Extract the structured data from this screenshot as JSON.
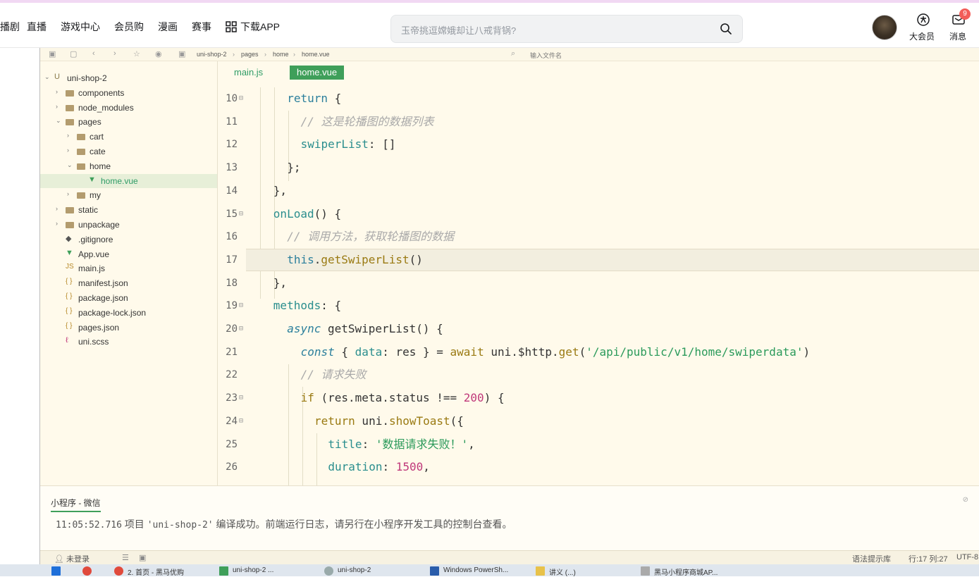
{
  "site_header": {
    "nav": [
      "播剧",
      "直播",
      "游戏中心",
      "会员购",
      "漫画",
      "赛事",
      "下载APP"
    ],
    "search_placeholder": "玉帝挑逗嫦娥却让八戒背锅?",
    "vip_label": "大会员",
    "messages_label": "消息",
    "message_badge": "9"
  },
  "ide": {
    "breadcrumb": [
      "uni-shop-2",
      "pages",
      "home",
      "home.vue"
    ],
    "file_search_placeholder": "输入文件名",
    "tree": [
      {
        "label": "uni-shop-2",
        "type": "project",
        "expanded": true
      },
      {
        "label": "components",
        "type": "folder"
      },
      {
        "label": "node_modules",
        "type": "folder"
      },
      {
        "label": "pages",
        "type": "folder",
        "expanded": true
      },
      {
        "label": "cart",
        "type": "folder"
      },
      {
        "label": "cate",
        "type": "folder"
      },
      {
        "label": "home",
        "type": "folder",
        "expanded": true
      },
      {
        "label": "home.vue",
        "type": "vue",
        "selected": true
      },
      {
        "label": "my",
        "type": "folder"
      },
      {
        "label": "static",
        "type": "folder"
      },
      {
        "label": "unpackage",
        "type": "folder"
      },
      {
        "label": ".gitignore",
        "type": "git"
      },
      {
        "label": "App.vue",
        "type": "vue"
      },
      {
        "label": "main.js",
        "type": "js"
      },
      {
        "label": "manifest.json",
        "type": "json"
      },
      {
        "label": "package.json",
        "type": "json"
      },
      {
        "label": "package-lock.json",
        "type": "json"
      },
      {
        "label": "pages.json",
        "type": "json"
      },
      {
        "label": "uni.scss",
        "type": "scss"
      }
    ],
    "tabs": [
      {
        "label": "main.js",
        "active": false
      },
      {
        "label": "home.vue",
        "active": true
      }
    ],
    "code_lines": [
      {
        "n": "10",
        "fold": true,
        "tokens": [
          [
            "kw",
            "return"
          ],
          [
            "p",
            " {"
          ]
        ]
      },
      {
        "n": "11",
        "fold": false,
        "tokens": [
          [
            "cm",
            "// 这是轮播图的数据列表"
          ]
        ]
      },
      {
        "n": "12",
        "fold": false,
        "tokens": [
          [
            "prop",
            "swiperList"
          ],
          [
            "p",
            ": []"
          ]
        ]
      },
      {
        "n": "13",
        "fold": false,
        "tokens": [
          [
            "p",
            "};"
          ]
        ]
      },
      {
        "n": "14",
        "fold": false,
        "tokens": [
          [
            "p",
            "},"
          ]
        ]
      },
      {
        "n": "15",
        "fold": true,
        "tokens": [
          [
            "prop",
            "onLoad"
          ],
          [
            "p",
            "() {"
          ]
        ]
      },
      {
        "n": "16",
        "fold": false,
        "tokens": [
          [
            "cm",
            "// 调用方法，获取轮播图的数据"
          ]
        ]
      },
      {
        "n": "17",
        "fold": false,
        "tokens": [
          [
            "kw",
            "this"
          ],
          [
            "p",
            "."
          ],
          [
            "fn",
            "getSwiperList"
          ],
          [
            "p",
            "()"
          ]
        ],
        "highlight": true
      },
      {
        "n": "18",
        "fold": false,
        "tokens": [
          [
            "p",
            "},"
          ]
        ]
      },
      {
        "n": "19",
        "fold": true,
        "tokens": [
          [
            "prop",
            "methods"
          ],
          [
            "p",
            ": {"
          ]
        ]
      },
      {
        "n": "20",
        "fold": true,
        "tokens": [
          [
            "ital",
            "async"
          ],
          [
            "p",
            " getSwiperList() {"
          ]
        ]
      },
      {
        "n": "21",
        "fold": false,
        "tokens": [
          [
            "ital",
            "const"
          ],
          [
            "p",
            " { "
          ],
          [
            "prop",
            "data"
          ],
          [
            "p",
            ": res } = "
          ],
          [
            "fn",
            "await"
          ],
          [
            "p",
            " uni.$http."
          ],
          [
            "fn",
            "get"
          ],
          [
            "p",
            "("
          ],
          [
            "str",
            "'/api/public/v1/home/swiperdata'"
          ],
          [
            "p",
            ")"
          ]
        ]
      },
      {
        "n": "22",
        "fold": false,
        "tokens": [
          [
            "cm",
            "// 请求失败"
          ]
        ]
      },
      {
        "n": "23",
        "fold": true,
        "tokens": [
          [
            "fn",
            "if"
          ],
          [
            "p",
            " (res.meta.status !== "
          ],
          [
            "num",
            "200"
          ],
          [
            "p",
            ") {"
          ]
        ]
      },
      {
        "n": "24",
        "fold": true,
        "tokens": [
          [
            "fn",
            "return"
          ],
          [
            "p",
            " uni."
          ],
          [
            "fn",
            "showToast"
          ],
          [
            "p",
            "({"
          ]
        ]
      },
      {
        "n": "25",
        "fold": false,
        "tokens": [
          [
            "prop",
            "title"
          ],
          [
            "p",
            ": "
          ],
          [
            "str",
            "'数据请求失败！'"
          ],
          [
            "p",
            ","
          ]
        ]
      },
      {
        "n": "26",
        "fold": false,
        "tokens": [
          [
            "prop",
            "duration"
          ],
          [
            "p",
            ": "
          ],
          [
            "num",
            "1500"
          ],
          [
            "p",
            ","
          ]
        ]
      }
    ],
    "console": {
      "tab_label": "小程序 - 微信",
      "time": "11:05:52.716",
      "message_pre": " 项目 ",
      "project": "'uni-shop-2'",
      "message_post": " 编译成功。前端运行日志，请另行在小程序开发工具的控制台查看。"
    },
    "status": {
      "login": "未登录",
      "position": "行:17  列:27",
      "encoding": "UTF-8",
      "syntax": "语法提示库"
    }
  },
  "taskbar": {
    "apps": [
      "2. 首页 - 黑马优购",
      "uni-shop-2 ...",
      "uni-shop-2",
      "Windows PowerSh...",
      "讲义 (...)",
      "黑马小程序商城AP..."
    ]
  }
}
